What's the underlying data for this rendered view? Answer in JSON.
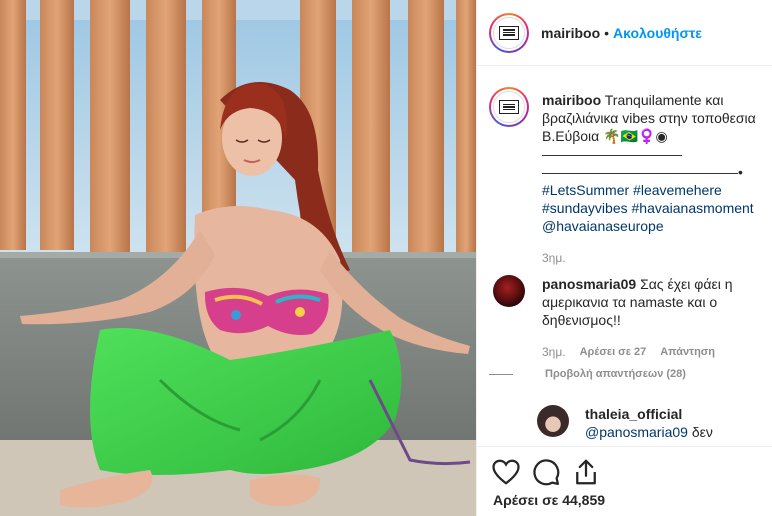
{
  "header": {
    "username": "mairiboo",
    "separator": "•",
    "follow_label": "Ακολουθήστε"
  },
  "caption": {
    "username": "mairiboo",
    "text": "Tranquilamente και βραζιλιάνικα vibes στην τοποθεσια Β.Εύβοια 🌴🇧🇷♀️◉",
    "line1": "——————————",
    "line2": "——————————————•",
    "hashtags": [
      "#LetsSummer",
      "#leavemehere",
      "#sundayvibes",
      "#havaianasmoment"
    ],
    "mention": "@havaianaseurope",
    "time": "3ημ."
  },
  "comments": [
    {
      "username": "panosmaria09",
      "text": "Σας έχει φάει η αμερικανια τα namaste και ο δηθενισμος!!",
      "time": "3ημ.",
      "likes": "Αρέσει σε 27",
      "reply_label": "Απάντηση",
      "view_replies": "Προβολή απαντήσεων (28)"
    },
    {
      "username": "thaleia_official",
      "mention": "@panosmaria09",
      "text": "δεν"
    }
  ],
  "actions": {
    "icons": [
      "heart-icon",
      "comment-icon",
      "share-icon"
    ],
    "likes_text": "Αρέσει σε 44,859"
  },
  "colors": {
    "link": "#0095f6",
    "hashtag": "#00376b",
    "meta": "#8e8e8e",
    "pants": "#3fd04a"
  }
}
